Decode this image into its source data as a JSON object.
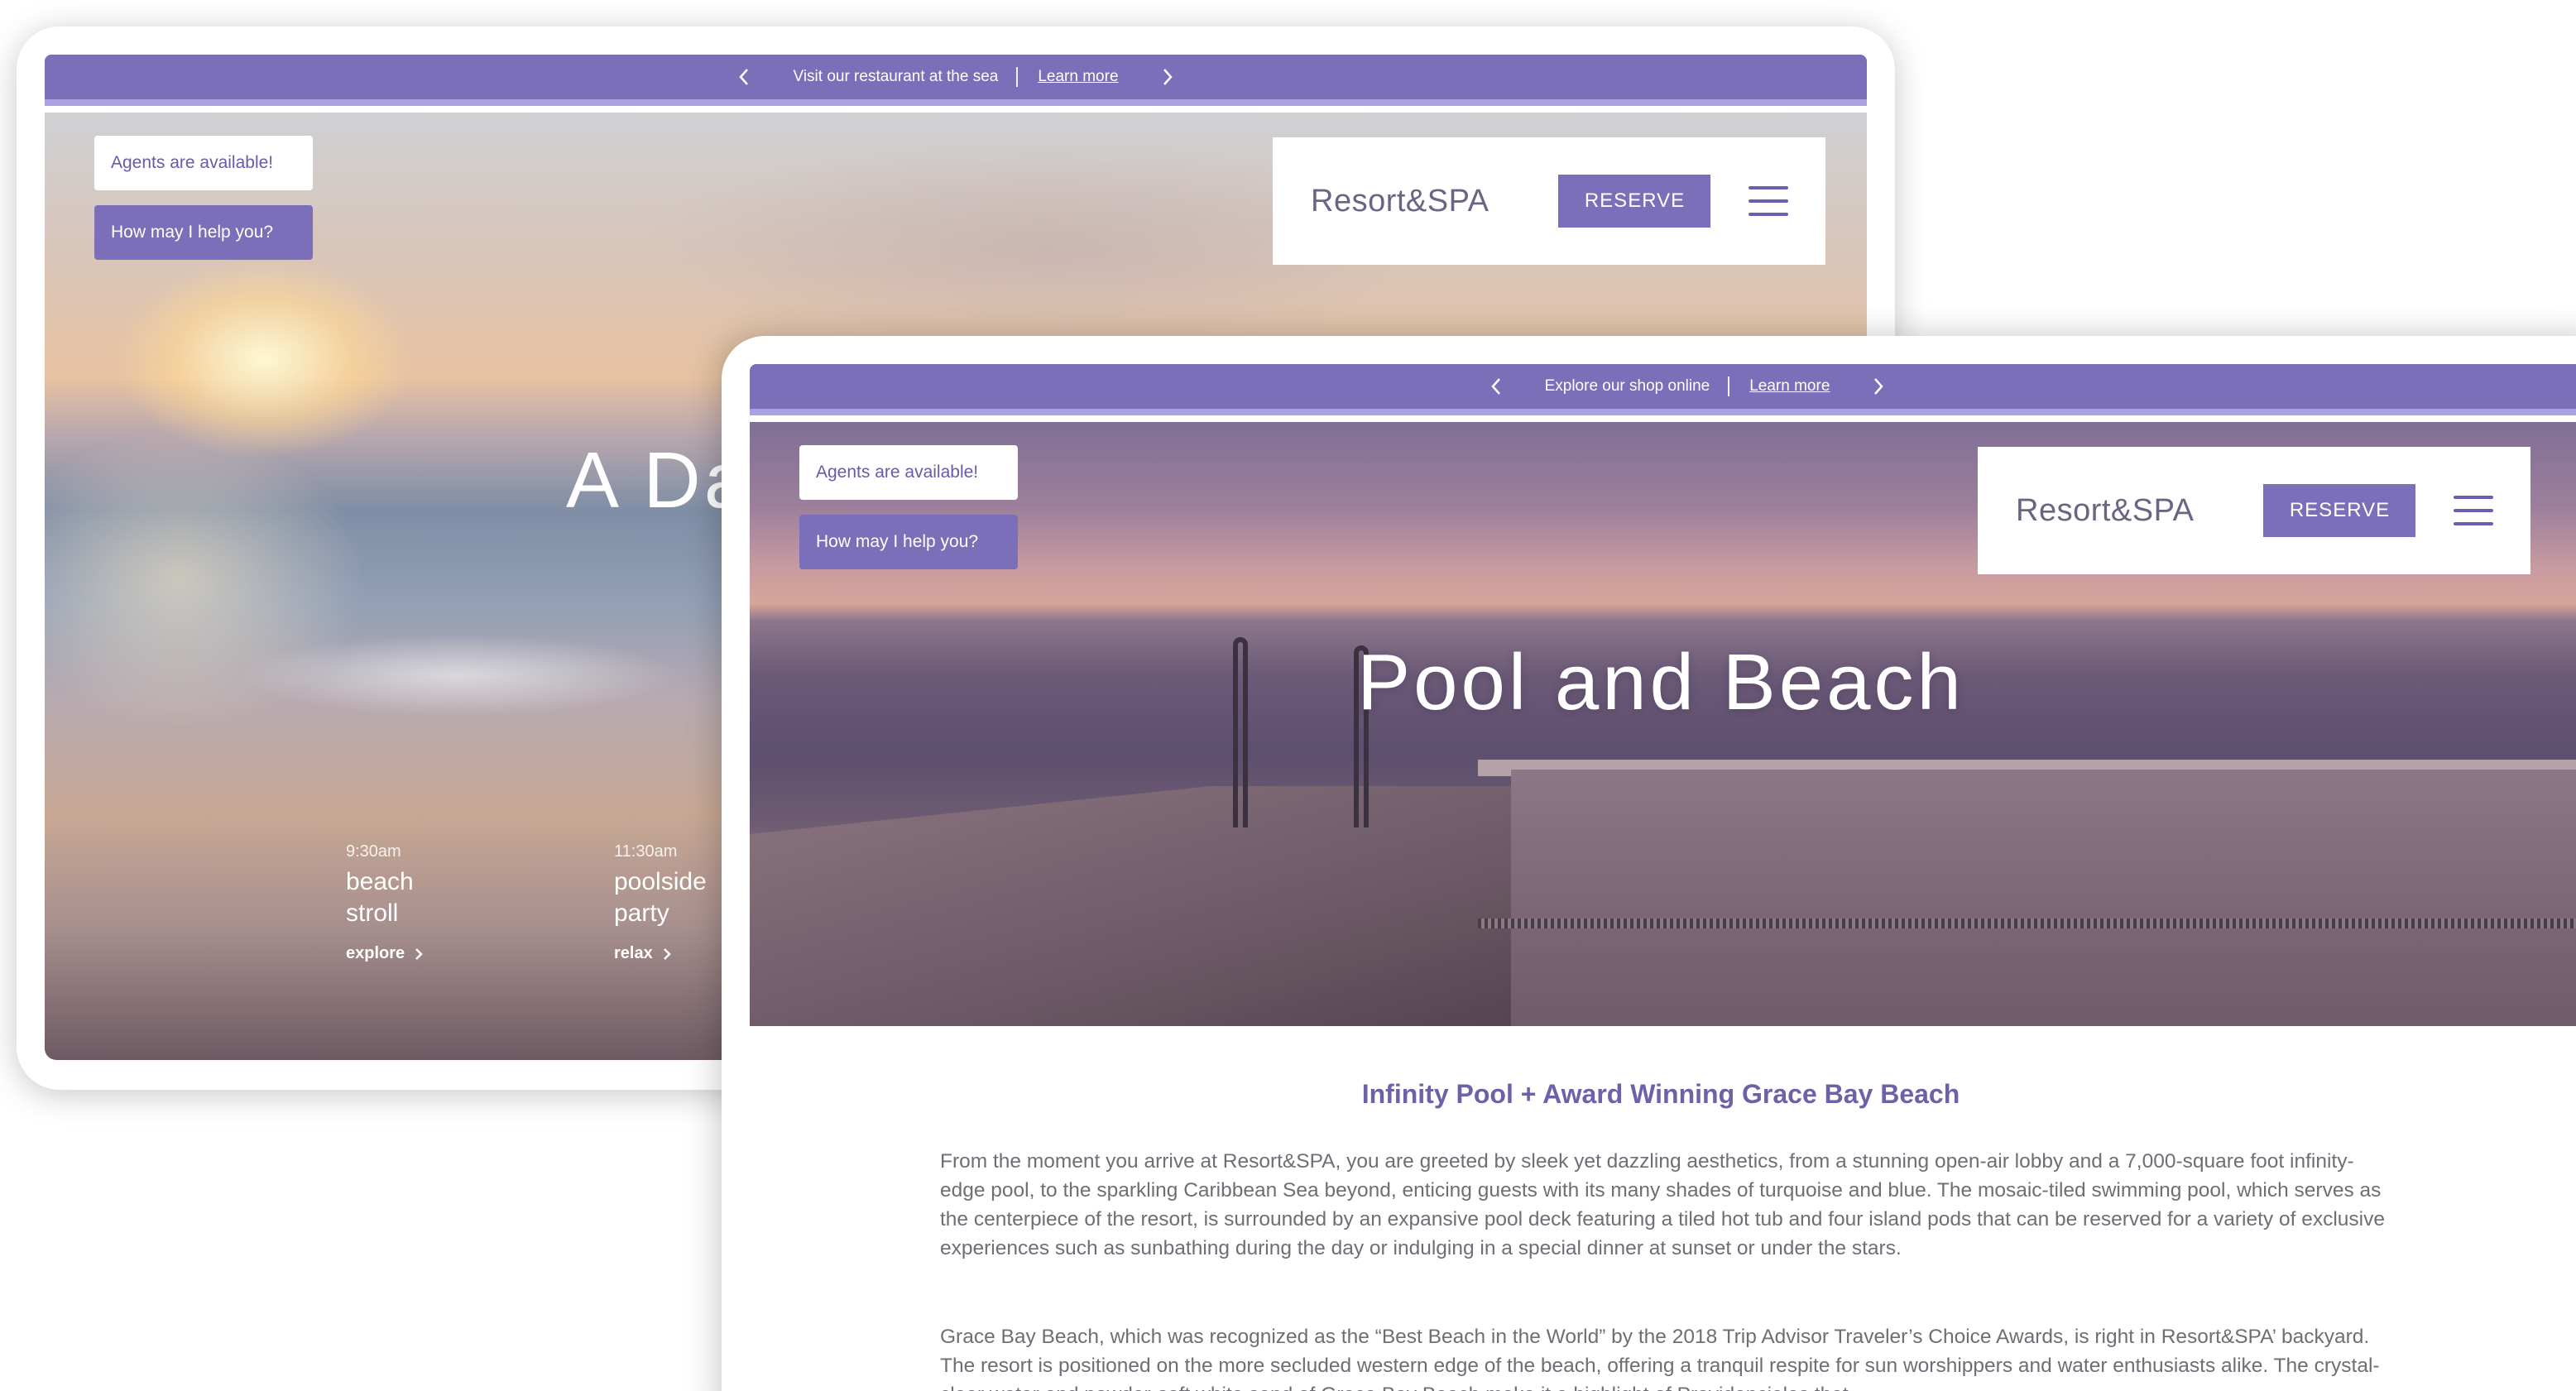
{
  "back_screen": {
    "promo": {
      "message": "Visit our restaurant at the sea",
      "link": "Learn more"
    },
    "agents": {
      "status": "Agents are available!",
      "help_button": "How may I help you?"
    },
    "header": {
      "brand": "Resort&SPA",
      "reserve_label": "RESERVE"
    },
    "hero_title": "A Da",
    "schedule": [
      {
        "time": "9:30am",
        "activity_line1": "beach",
        "activity_line2": "stroll",
        "link": "explore"
      },
      {
        "time": "11:30am",
        "activity_line1": "poolside",
        "activity_line2": "party",
        "link": "relax"
      }
    ]
  },
  "front_screen": {
    "promo": {
      "message": "Explore our shop online",
      "link": "Learn more"
    },
    "agents": {
      "status": "Agents are available!",
      "help_button": "How may I help you?"
    },
    "header": {
      "brand": "Resort&SPA",
      "reserve_label": "RESERVE"
    },
    "hero_title": "Pool and Beach",
    "article": {
      "title": "Infinity Pool + Award Winning Grace Bay Beach",
      "para1": "From the moment you arrive at Resort&SPA, you are greeted by sleek yet dazzling aesthetics, from a stunning open-air lobby and a 7,000-square foot infinity-edge pool, to the sparkling Caribbean Sea beyond, enticing guests with its many shades of turquoise and blue. The mosaic-tiled swimming pool, which serves as the centerpiece of the resort, is surrounded by an expansive pool deck featuring a tiled hot tub and four island pods that can be reserved for a variety of exclusive experiences such as sunbathing during the day or indulging in a special dinner at sunset or under the stars.",
      "para2": "Grace Bay Beach, which was recognized as the “Best Beach in the World” by the 2018 Trip Advisor Traveler’s Choice Awards, is right in Resort&SPA’ backyard. The resort is positioned on the more secluded western edge of the beach, offering a tranquil respite for sun worshippers and water enthusiasts alike. The crystal-clear water and powder-soft white sand of Grace Bay Beach make it a highlight of Providenciales that"
    }
  },
  "colors": {
    "accent": "#7a6fb8",
    "accent_light": "#aaa2e0",
    "text_body": "#6e6e76",
    "title_purple": "#6b62a8"
  },
  "icons": [
    "chevron-left-icon",
    "chevron-right-icon",
    "hamburger-menu-icon"
  ]
}
